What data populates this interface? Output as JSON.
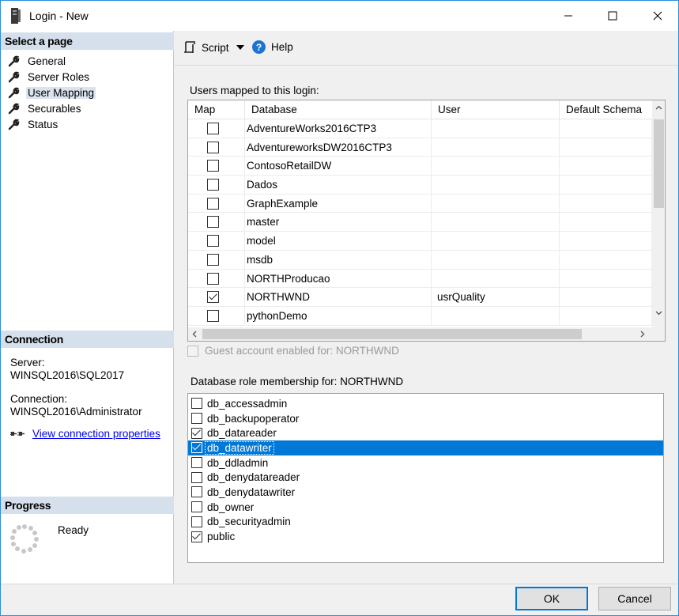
{
  "window": {
    "title": "Login - New"
  },
  "left": {
    "select_page_header": "Select a page",
    "pages": [
      {
        "label": "General",
        "selected": false
      },
      {
        "label": "Server Roles",
        "selected": false
      },
      {
        "label": "User Mapping",
        "selected": true
      },
      {
        "label": "Securables",
        "selected": false
      },
      {
        "label": "Status",
        "selected": false
      }
    ],
    "connection_header": "Connection",
    "server_label": "Server:",
    "server_value": "WINSQL2016\\SQL2017",
    "connection_label": "Connection:",
    "connection_value": "WINSQL2016\\Administrator",
    "view_connection_link": "View connection properties",
    "progress_header": "Progress",
    "progress_status": "Ready"
  },
  "toolbar": {
    "script_label": "Script",
    "help_label": "Help"
  },
  "mapping": {
    "label": "Users mapped to this login:",
    "columns": [
      "Map",
      "Database",
      "User",
      "Default Schema"
    ],
    "rows": [
      {
        "checked": false,
        "database": "AdventureWorks2016CTP3",
        "user": "",
        "schema": ""
      },
      {
        "checked": false,
        "database": "AdventureworksDW2016CTP3",
        "user": "",
        "schema": ""
      },
      {
        "checked": false,
        "database": "ContosoRetailDW",
        "user": "",
        "schema": ""
      },
      {
        "checked": false,
        "database": "Dados",
        "user": "",
        "schema": ""
      },
      {
        "checked": false,
        "database": "GraphExample",
        "user": "",
        "schema": ""
      },
      {
        "checked": false,
        "database": "master",
        "user": "",
        "schema": ""
      },
      {
        "checked": false,
        "database": "model",
        "user": "",
        "schema": ""
      },
      {
        "checked": false,
        "database": "msdb",
        "user": "",
        "schema": ""
      },
      {
        "checked": false,
        "database": "NORTHProducao",
        "user": "",
        "schema": ""
      },
      {
        "checked": true,
        "database": "NORTHWND",
        "user": "usrQuality",
        "schema": ""
      },
      {
        "checked": false,
        "database": "pythonDemo",
        "user": "",
        "schema": ""
      }
    ]
  },
  "guest": {
    "label": "Guest account enabled for: NORTHWND",
    "checked": false,
    "enabled": false
  },
  "roles": {
    "label": "Database role membership for: NORTHWND",
    "items": [
      {
        "name": "db_accessadmin",
        "checked": false,
        "selected": false
      },
      {
        "name": "db_backupoperator",
        "checked": false,
        "selected": false
      },
      {
        "name": "db_datareader",
        "checked": true,
        "selected": false
      },
      {
        "name": "db_datawriter",
        "checked": true,
        "selected": true
      },
      {
        "name": "db_ddladmin",
        "checked": false,
        "selected": false
      },
      {
        "name": "db_denydatareader",
        "checked": false,
        "selected": false
      },
      {
        "name": "db_denydatawriter",
        "checked": false,
        "selected": false
      },
      {
        "name": "db_owner",
        "checked": false,
        "selected": false
      },
      {
        "name": "db_securityadmin",
        "checked": false,
        "selected": false
      },
      {
        "name": "public",
        "checked": true,
        "selected": false
      }
    ]
  },
  "footer": {
    "ok_label": "OK",
    "cancel_label": "Cancel"
  },
  "colors": {
    "accent": "#0078d7",
    "section_header_bg": "#d5e0ec",
    "link": "#0000ee"
  }
}
